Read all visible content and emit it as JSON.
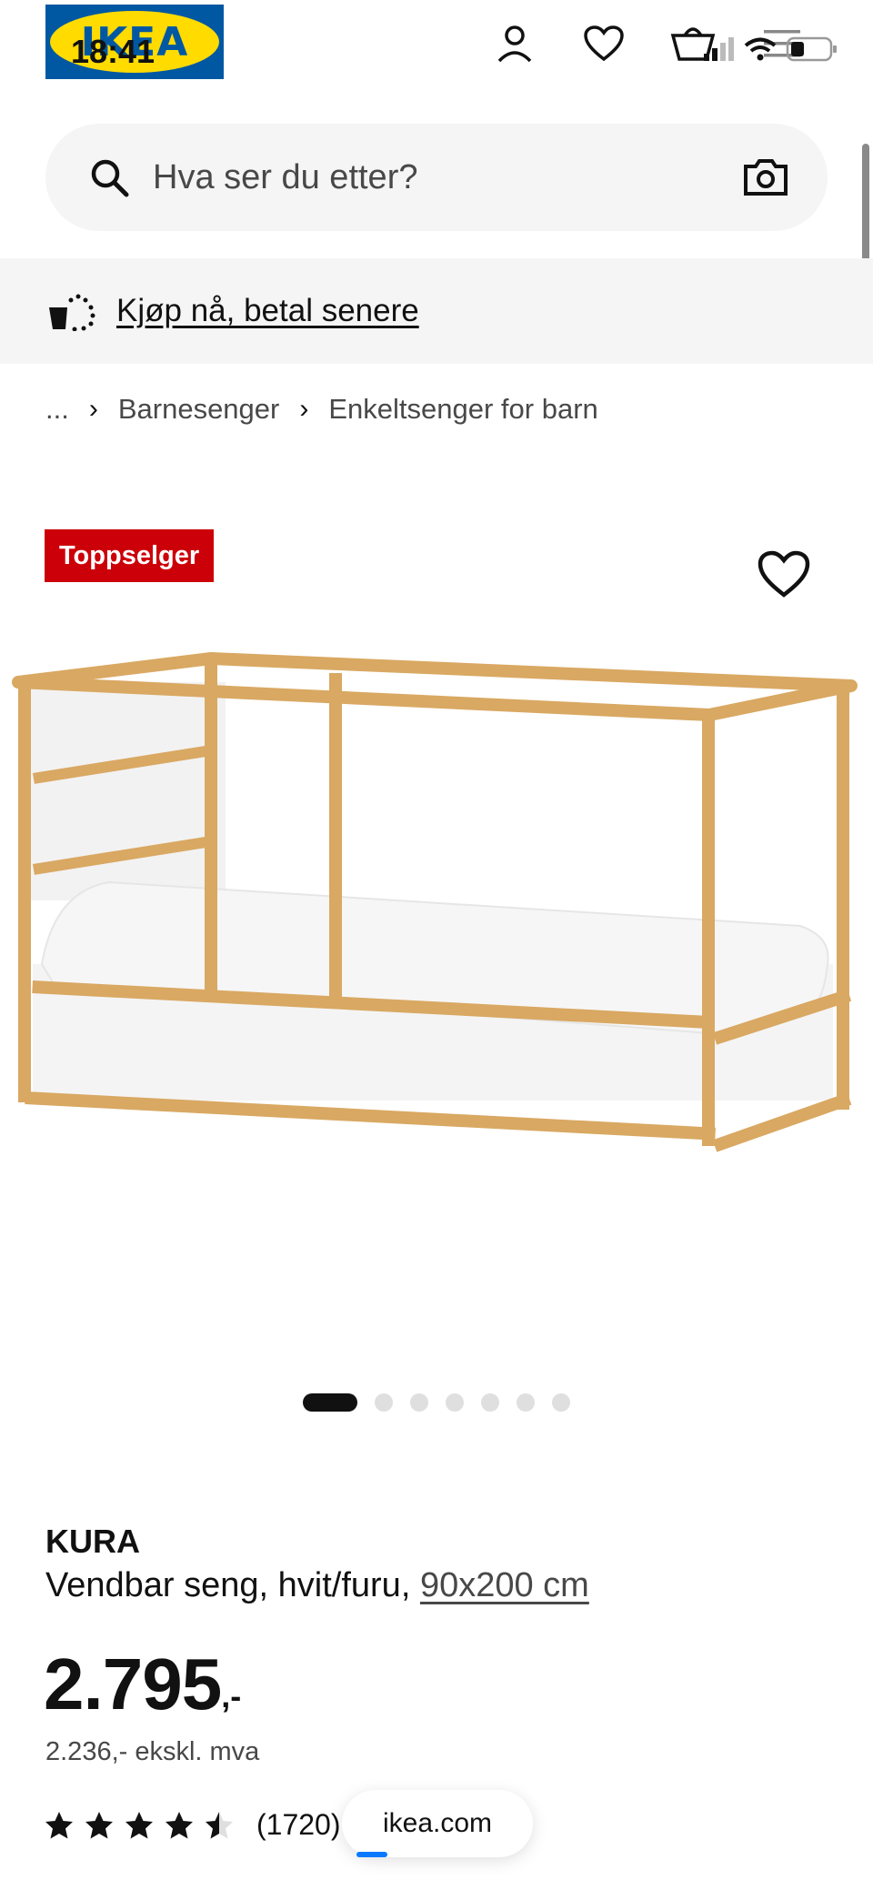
{
  "status_bar": {
    "time": "18:41"
  },
  "header": {
    "logo_text": "IKEA"
  },
  "search": {
    "placeholder": "Hva ser du etter?"
  },
  "promo": {
    "label": "Kjøp nå, betal senere"
  },
  "breadcrumb": {
    "ellipsis": "...",
    "items": [
      "Barnesenger",
      "Enkeltsenger for barn"
    ]
  },
  "product": {
    "badge": "Toppselger",
    "name": "KURA",
    "description": "Vendbar seng, hvit/furu,",
    "size_link": "90x200 cm",
    "price_main": "2.795",
    "price_suffix": ",-",
    "price_ex_vat": "2.236,- ekskl. mva",
    "rating": 4.5,
    "rating_count": "(1720)"
  },
  "carousel": {
    "total": 7,
    "active_index": 0
  },
  "browser": {
    "url": "ikea.com"
  },
  "colors": {
    "badge_red": "#cc0008",
    "ikea_blue": "#0058a3",
    "ikea_yellow": "#ffdb00"
  }
}
